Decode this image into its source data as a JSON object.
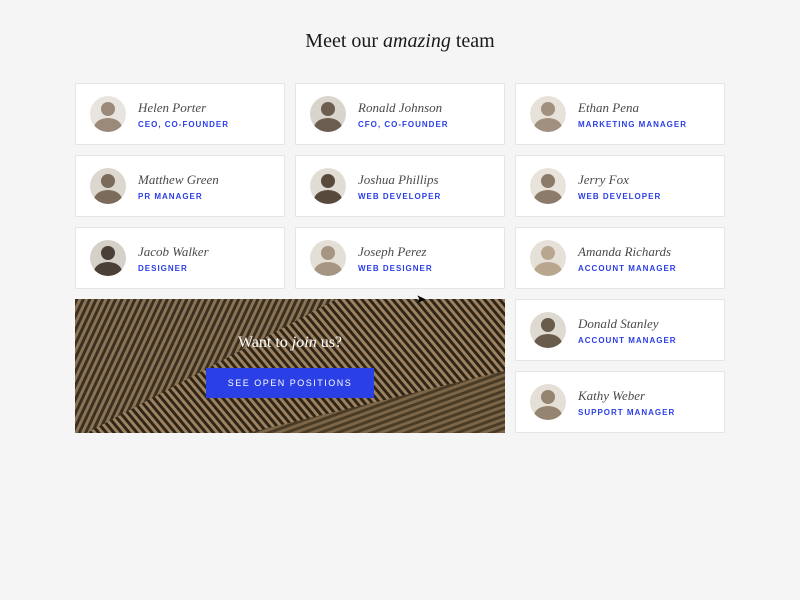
{
  "heading": {
    "prefix": "Meet our ",
    "em": "amazing",
    "suffix": " team"
  },
  "team": [
    {
      "name": "Helen Porter",
      "role": "CEO, CO-FOUNDER"
    },
    {
      "name": "Ronald Johnson",
      "role": "CFO, CO-FOUNDER"
    },
    {
      "name": "Ethan Pena",
      "role": "MARKETING MANAGER"
    },
    {
      "name": "Matthew Green",
      "role": "PR MANAGER"
    },
    {
      "name": "Joshua Phillips",
      "role": "WEB DEVELOPER"
    },
    {
      "name": "Jerry Fox",
      "role": "WEB DEVELOPER"
    },
    {
      "name": "Jacob Walker",
      "role": "DESIGNER"
    },
    {
      "name": "Joseph Perez",
      "role": "WEB DESIGNER"
    },
    {
      "name": "Amanda Richards",
      "role": "ACCOUNT MANAGER"
    },
    {
      "name": "Donald Stanley",
      "role": "ACCOUNT MANAGER"
    },
    {
      "name": "Kathy Weber",
      "role": "SUPPORT MANAGER"
    }
  ],
  "cta": {
    "prefix": "Want to ",
    "em": "join",
    "suffix": " us?",
    "button_label": "SEE OPEN POSITIONS"
  }
}
